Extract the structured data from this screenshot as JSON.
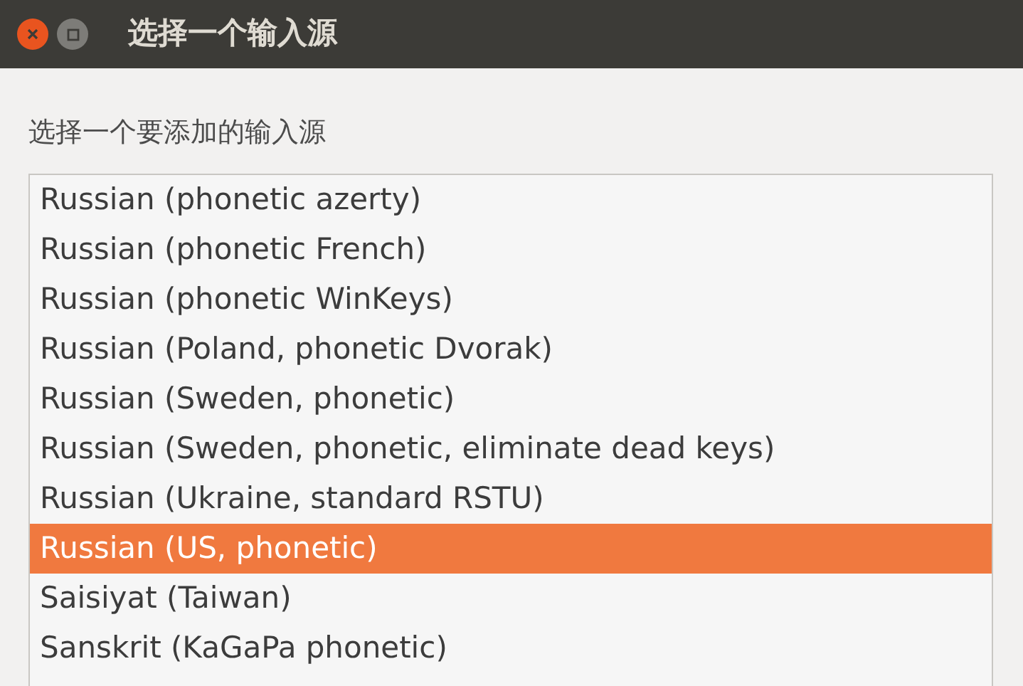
{
  "window": {
    "title": "选择一个输入源"
  },
  "prompt": "选择一个要添加的输入源",
  "items": [
    {
      "label": "Russian (phonetic azerty)",
      "selected": false
    },
    {
      "label": "Russian (phonetic French)",
      "selected": false
    },
    {
      "label": "Russian (phonetic WinKeys)",
      "selected": false
    },
    {
      "label": "Russian (Poland, phonetic Dvorak)",
      "selected": false
    },
    {
      "label": "Russian (Sweden, phonetic)",
      "selected": false
    },
    {
      "label": "Russian (Sweden, phonetic, eliminate dead keys)",
      "selected": false
    },
    {
      "label": "Russian (Ukraine, standard RSTU)",
      "selected": false
    },
    {
      "label": "Russian (US, phonetic)",
      "selected": true
    },
    {
      "label": "Saisiyat (Taiwan)",
      "selected": false
    },
    {
      "label": "Sanskrit (KaGaPa phonetic)",
      "selected": false
    }
  ]
}
